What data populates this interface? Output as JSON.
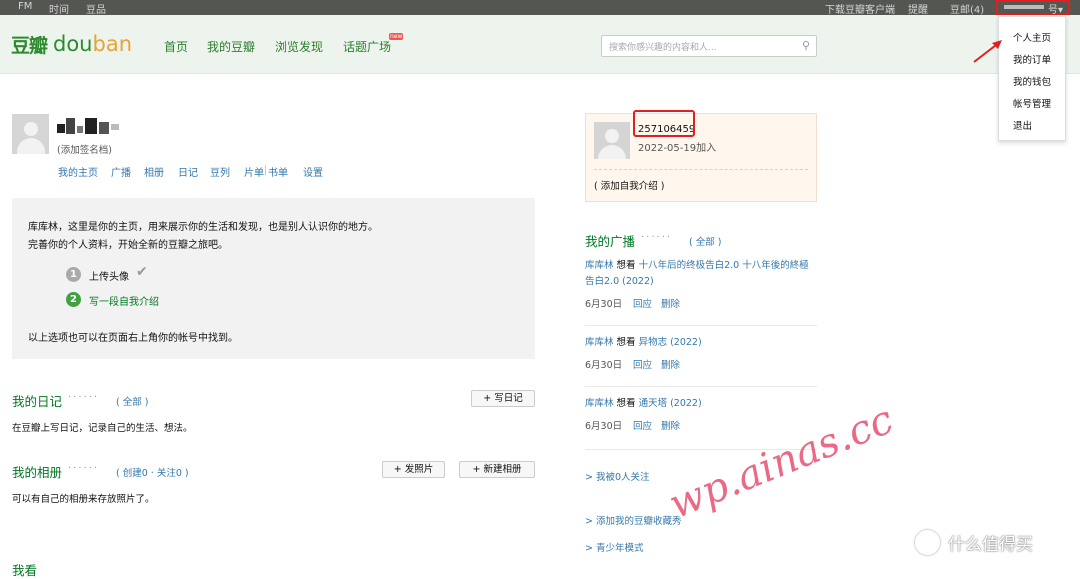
{
  "topbar": {
    "left": [
      "FM",
      "时间",
      "豆品"
    ],
    "download": "下载豆瓣客户端",
    "remind": "提醒",
    "mail": "豆邮(4)",
    "account_suffix": "号"
  },
  "dropdown": [
    "个人主页",
    "我的订单",
    "我的钱包",
    "帐号管理",
    "退出"
  ],
  "nav": {
    "logo_cn": "豆瓣",
    "logo_en_a": "dou",
    "logo_en_b": "ban",
    "items": [
      "首页",
      "我的豆瓣",
      "浏览发现",
      "话题广场"
    ],
    "new_badge": "new",
    "search_placeholder": "搜索你感兴趣的内容和人..."
  },
  "profile": {
    "signature": "(添加签名档)",
    "links": [
      "我的主页",
      "广播",
      "相册",
      "日记",
      "豆列",
      "片单",
      "书单",
      "设置"
    ]
  },
  "intro": {
    "line1": "库库林，这里是你的主页，用来展示你的生活和发现，也是别人认识你的地方。",
    "line2": "完善你的个人资料，开始全新的豆瓣之旅吧。",
    "step1_num": "1",
    "step1": "上传头像",
    "step2_num": "2",
    "step2": "写一段自我介绍",
    "footer": "以上选项也可以在页面右上角你的帐号中找到。"
  },
  "diary": {
    "title": "我的日记",
    "dots": "······",
    "link": "( 全部 )",
    "button": "写日记",
    "desc": "在豆瓣上写日记，记录自己的生活、想法。"
  },
  "album": {
    "title": "我的相册",
    "dots": "······",
    "link": "( 创建0 · 关注0 )",
    "btn_upload": "发照片",
    "btn_new": "新建相册",
    "desc": "可以有自己的相册来存放照片了。"
  },
  "watch": {
    "title": "我看"
  },
  "info": {
    "uid": "257106459",
    "joined": "2022-05-19加入",
    "add_intro": "( 添加自我介绍 )"
  },
  "broadcast": {
    "title": "我的广播",
    "dots": "······",
    "link": "( 全部 )",
    "items": [
      {
        "user": "库库林",
        "verb": " 想看 ",
        "title": "十八年后的终极告白2.0 十八年後的終極告白2.0 (2022)",
        "date": "6月30日",
        "reply": "回应",
        "delete": "删除"
      },
      {
        "user": "库库林",
        "verb": " 想看 ",
        "title": "异物志 (2022)",
        "date": "6月30日",
        "reply": "回应",
        "delete": "删除"
      },
      {
        "user": "库库林",
        "verb": " 想看 ",
        "title": "通天塔 (2022)",
        "date": "6月30日",
        "reply": "回应",
        "delete": "删除"
      }
    ]
  },
  "right_links": [
    "> 我被0人关注",
    "> 添加我的豆瓣收藏秀",
    "> 青少年模式"
  ],
  "watermark": "wp.ainas.cc",
  "source_mark": "什么值得买",
  "source_icon": "值",
  "colors": {
    "accent_green": "#2d7d2d",
    "link_blue": "#37a",
    "highlight_red": "#e02020"
  }
}
